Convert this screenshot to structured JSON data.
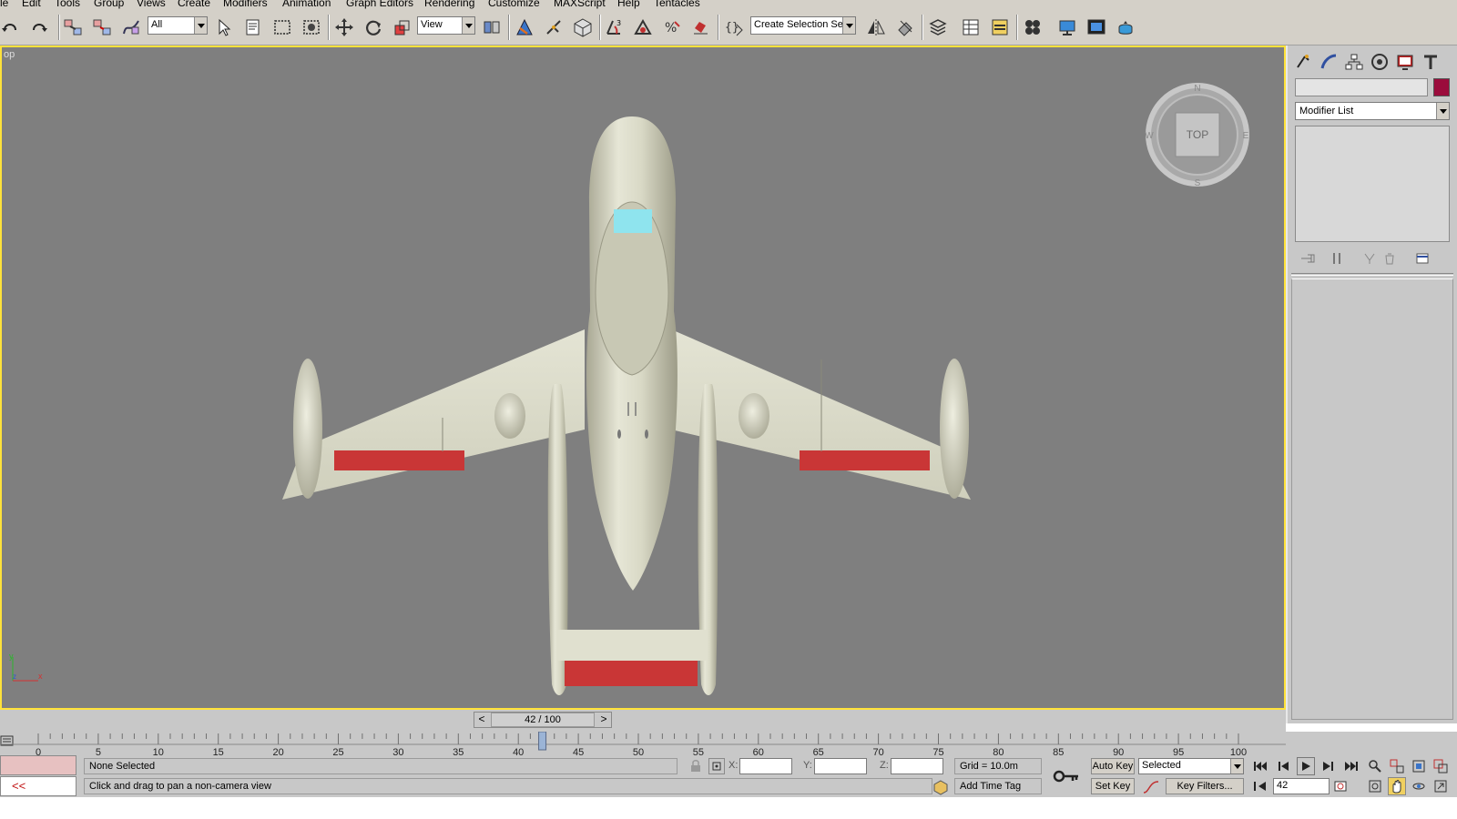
{
  "menu": {
    "items": [
      "le",
      "Edit",
      "Tools",
      "Group",
      "Views",
      "Create",
      "Modifiers",
      "Animation",
      "Graph Editors",
      "Rendering",
      "Customize",
      "MAXScript",
      "Help",
      "Tentacles"
    ]
  },
  "toolbar": {
    "selection_filter": "All",
    "reference_coord": "View",
    "named_selection_set": "Create Selection Set",
    "icons": [
      "undo-icon",
      "redo-icon",
      "select-and-link-icon",
      "unlink-selection-icon",
      "bind-to-space-warp-icon",
      "select-object-icon",
      "select-by-name-icon",
      "rectangular-selection-region-icon",
      "window-crossing-icon",
      "select-and-move-icon",
      "select-and-rotate-icon",
      "select-and-scale-icon",
      "use-pivot-center-icon",
      "select-and-manipulate-icon",
      "keyboard-shortcut-override-icon",
      "snaps-toggle-icon",
      "angle-snap-icon",
      "percent-snap-icon",
      "spinner-snap-icon",
      "edit-named-selection-icon",
      "mirror-icon",
      "align-icon",
      "layer-manager-icon",
      "graphite-modeling-icon",
      "curve-editor-icon",
      "schematic-view-icon",
      "material-editor-icon",
      "render-setup-icon",
      "rendered-frame-window-icon",
      "render-production-icon"
    ]
  },
  "viewport": {
    "label": "op",
    "viewcube_face": "TOP",
    "compass": {
      "north": "N",
      "south": "S",
      "east": "E",
      "west": "W"
    },
    "axis": {
      "y": "y",
      "x": "x",
      "z": "z"
    },
    "colors": {
      "background": "#7f7f7f",
      "active_border": "#ffe23a",
      "model_body": "#dcdcc8",
      "stripe": "#c93636",
      "canopy": "#8fe4ee"
    }
  },
  "command_panel": {
    "tabs": [
      "create-tab-icon",
      "modify-tab-icon",
      "hierarchy-tab-icon",
      "motion-tab-icon",
      "display-tab-icon",
      "utilities-tab-icon"
    ],
    "object_name": "",
    "object_color": "#9b0c3c",
    "modifier_list": "Modifier List"
  },
  "time_slider": {
    "position_label": "42 / 100",
    "prev": "<",
    "next": ">"
  },
  "track_bar": {
    "ticks": [
      0,
      5,
      10,
      15,
      20,
      25,
      30,
      35,
      40,
      45,
      50,
      55,
      60,
      65,
      70,
      75,
      80,
      85,
      90,
      95,
      100
    ],
    "current_frame": 42
  },
  "status_bar": {
    "maxscript_expand": "<<",
    "selection": "None Selected",
    "prompt": "Click and drag to pan a non-camera view",
    "x_label": "X:",
    "y_label": "Y:",
    "z_label": "Z:",
    "x_value": "",
    "y_value": "",
    "z_value": "",
    "grid": "Grid = 10.0m",
    "add_time_tag": "Add Time Tag",
    "auto_key": "Auto Key",
    "set_key": "Set Key",
    "key_mode": "Selected",
    "key_filters": "Key Filters...",
    "current_frame": "42"
  }
}
